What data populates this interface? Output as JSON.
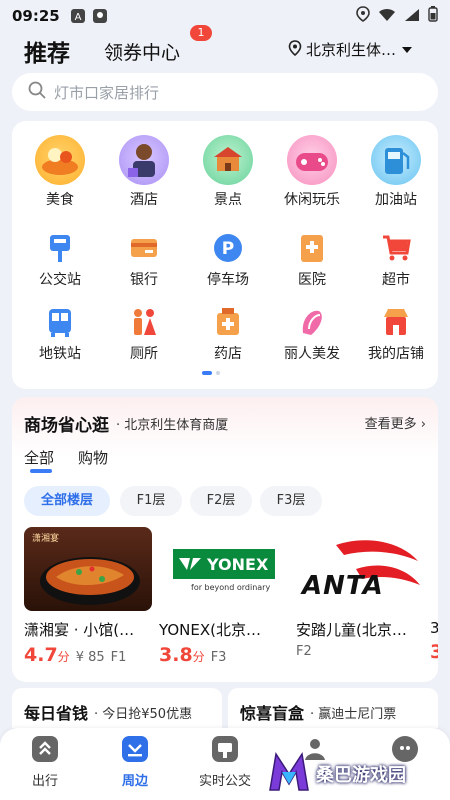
{
  "status_bar": {
    "time": "09:25"
  },
  "header": {
    "tab_recommend": "推荐",
    "tab_coupon": "领券中心",
    "coupon_badge": "1",
    "location": "北京利生体…"
  },
  "search": {
    "placeholder": "灯市口家居排行"
  },
  "categories": {
    "row1": [
      {
        "label": "美食",
        "icon": "food-icon"
      },
      {
        "label": "酒店",
        "icon": "hotel-icon"
      },
      {
        "label": "景点",
        "icon": "scenic-icon"
      },
      {
        "label": "休闲玩乐",
        "icon": "leisure-icon"
      },
      {
        "label": "加油站",
        "icon": "gas-station-icon"
      }
    ],
    "row2": [
      {
        "label": "公交站",
        "icon": "bus-stop-icon"
      },
      {
        "label": "银行",
        "icon": "bank-icon"
      },
      {
        "label": "停车场",
        "icon": "parking-icon"
      },
      {
        "label": "医院",
        "icon": "hospital-icon"
      },
      {
        "label": "超市",
        "icon": "supermarket-icon"
      }
    ],
    "row3": [
      {
        "label": "地铁站",
        "icon": "subway-icon"
      },
      {
        "label": "厕所",
        "icon": "toilet-icon"
      },
      {
        "label": "药店",
        "icon": "pharmacy-icon"
      },
      {
        "label": "丽人美发",
        "icon": "beauty-icon"
      },
      {
        "label": "我的店铺",
        "icon": "my-shop-icon"
      }
    ]
  },
  "mall": {
    "title": "商场省心逛",
    "subtitle": "· 北京利生体育商厦",
    "more": "查看更多",
    "tabs": [
      "全部",
      "购物"
    ],
    "floors": [
      "全部楼层",
      "F1层",
      "F2层",
      "F3层"
    ],
    "shops": [
      {
        "name": "潇湘宴 · 小馆(…",
        "score": "4.7",
        "score_unit": "分",
        "price": "¥ 85",
        "floor": "F1",
        "img_text": "潇湘宴"
      },
      {
        "name": "YONEX(北京…",
        "score": "3.8",
        "score_unit": "分",
        "price": "",
        "floor": "F3",
        "logo_text": "YONEX",
        "logo_sub": "for beyond ordinary"
      },
      {
        "name": "安踏儿童(北京…",
        "score": "",
        "score_unit": "",
        "price": "",
        "floor": "F2",
        "logo_text": "ANTA"
      },
      {
        "name": "3",
        "score": "3"
      }
    ]
  },
  "promos": [
    {
      "title": "每日省钱",
      "sub": "· 今日抢¥50优惠"
    },
    {
      "title": "惊喜盲盒",
      "sub": "· 赢迪士尼门票"
    }
  ],
  "bottom_nav": [
    {
      "label": "出行",
      "icon": "travel-icon",
      "active": false
    },
    {
      "label": "周边",
      "icon": "nearby-icon",
      "active": true
    },
    {
      "label": "实时公交",
      "icon": "realtime-bus-icon",
      "active": false
    },
    {
      "label": "",
      "icon": "community-icon",
      "active": false
    },
    {
      "label": "",
      "icon": "profile-icon",
      "active": false
    }
  ],
  "watermark": {
    "text": "桑巴游戏园"
  },
  "colors": {
    "accent": "#2f6fe8",
    "score_red": "#f0473a",
    "background": "#eef1f7"
  }
}
